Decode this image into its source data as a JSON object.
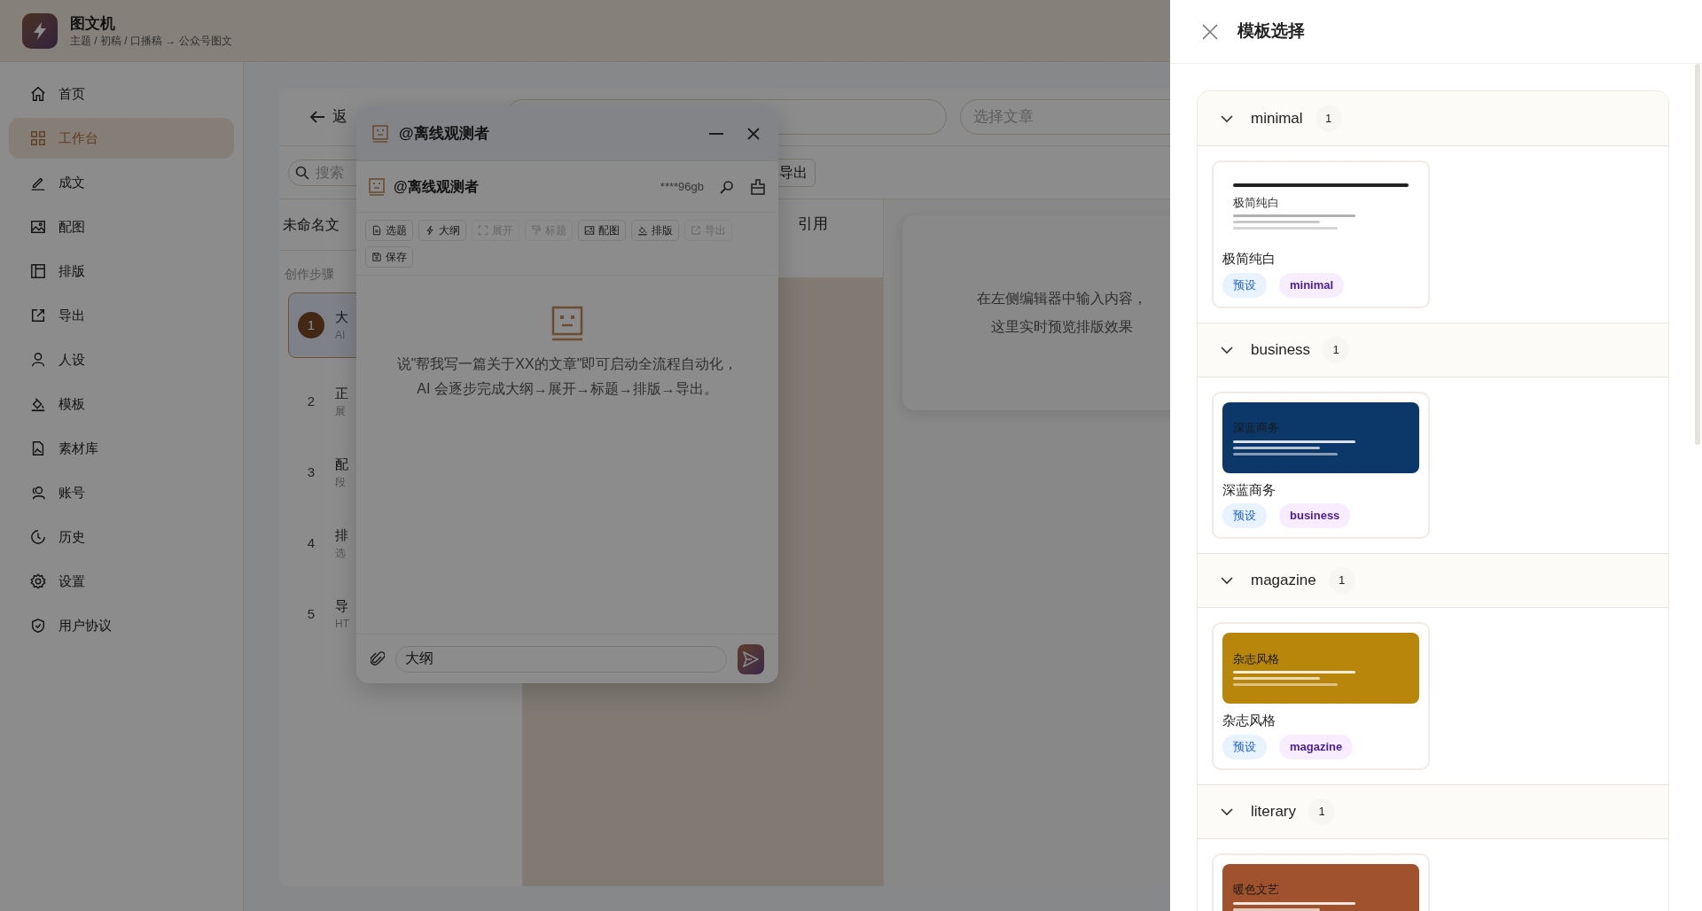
{
  "app": {
    "title": "图文机",
    "breadcrumb": "主题 / 初稿 / 口播稿 → 公众号图文"
  },
  "sidebar": {
    "items": [
      {
        "label": "首页",
        "selected": false
      },
      {
        "label": "工作台",
        "selected": true
      },
      {
        "label": "成文",
        "selected": false
      },
      {
        "label": "配图",
        "selected": false
      },
      {
        "label": "排版",
        "selected": false
      },
      {
        "label": "导出",
        "selected": false
      },
      {
        "label": "人设",
        "selected": false
      },
      {
        "label": "模板",
        "selected": false
      },
      {
        "label": "素材库",
        "selected": false
      },
      {
        "label": "账号",
        "selected": false
      },
      {
        "label": "历史",
        "selected": false
      },
      {
        "label": "设置",
        "selected": false
      },
      {
        "label": "用户协议",
        "selected": false
      }
    ]
  },
  "editor": {
    "back": "返",
    "article_select_placeholder": "选择文章",
    "search_placeholder": "搜索",
    "export_button": "导出",
    "doc_title": "未命名文",
    "format_button": "引用",
    "steps_heading": "创作步骤",
    "steps": [
      {
        "number": "1",
        "title": "大",
        "subtitle": "AI",
        "selected": true
      },
      {
        "number": "2",
        "title": "正",
        "subtitle": "展",
        "selected": false
      },
      {
        "number": "3",
        "title": "配",
        "subtitle": "段",
        "selected": false
      },
      {
        "number": "4",
        "title": "排",
        "subtitle": "选",
        "selected": false
      },
      {
        "number": "5",
        "title": "导",
        "subtitle": "HT",
        "selected": false
      }
    ],
    "preview_hint": [
      "在左侧编辑器中输入内容，",
      "这里实时预览排版效果"
    ]
  },
  "chat": {
    "title": "@离线观测者",
    "agent_name": "@离线观测者",
    "key_masked": "****96gb",
    "actions": [
      {
        "label": "选题",
        "disabled": false
      },
      {
        "label": "大纲",
        "disabled": false
      },
      {
        "label": "展开",
        "disabled": true
      },
      {
        "label": "标题",
        "disabled": true
      },
      {
        "label": "配图",
        "disabled": false
      },
      {
        "label": "排版",
        "disabled": false
      },
      {
        "label": "导出",
        "disabled": true
      },
      {
        "label": "保存",
        "disabled": false
      }
    ],
    "empty_message": "说\"帮我写一篇关于XX的文章\"即可启动全流程自动化，AI 会逐步完成大纲→展开→标题→排版→导出。",
    "input_value": "大纲"
  },
  "drawer": {
    "title": "模板选择",
    "groups": [
      {
        "name": "minimal",
        "count": "1",
        "expanded": true,
        "templates": [
          {
            "kind": "light",
            "color": "#ffffff",
            "preview_title": "极简纯白",
            "name": "极简纯白",
            "tags": [
              "预设",
              "minimal"
            ]
          }
        ]
      },
      {
        "name": "business",
        "count": "1",
        "expanded": true,
        "templates": [
          {
            "kind": "solid",
            "color": "#0b3868",
            "preview_title": "深蓝商务",
            "name": "深蓝商务",
            "tags": [
              "预设",
              "business"
            ]
          }
        ]
      },
      {
        "name": "magazine",
        "count": "1",
        "expanded": true,
        "templates": [
          {
            "kind": "solid",
            "color": "#b8860b",
            "preview_title": "杂志风格",
            "name": "杂志风格",
            "tags": [
              "预设",
              "magazine"
            ]
          }
        ]
      },
      {
        "name": "literary",
        "count": "1",
        "expanded": true,
        "templates": [
          {
            "kind": "solid",
            "color": "#a0522d",
            "preview_title": "暖色文艺"
          }
        ]
      }
    ]
  }
}
